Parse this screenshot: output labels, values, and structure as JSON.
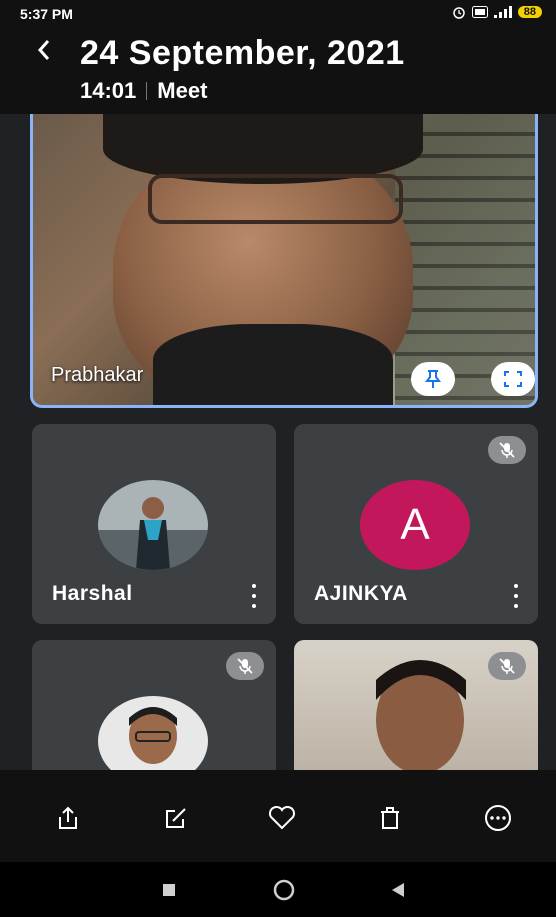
{
  "status_bar": {
    "time": "5:37 PM",
    "battery": "88"
  },
  "header": {
    "title": "24 September, 2021",
    "time": "14:01",
    "app": "Meet"
  },
  "main_participant": {
    "name": "Prabhakar"
  },
  "participants": [
    {
      "name": "Harshal",
      "muted": false
    },
    {
      "name": "AJINKYA",
      "initial": "A",
      "avatar_color": "#c2185b",
      "muted": true
    },
    {
      "name": "",
      "muted": true
    },
    {
      "name": "",
      "muted": true
    }
  ],
  "toolbar": {
    "icons": [
      "share-icon",
      "edit-icon",
      "favorite-icon",
      "delete-icon",
      "more-icon"
    ]
  },
  "nav_bar": {
    "icons": [
      "recents-icon",
      "home-icon",
      "back-icon"
    ]
  },
  "colors": {
    "accent": "#8ab4f8",
    "tile": "#3c4043",
    "background": "#202124"
  }
}
